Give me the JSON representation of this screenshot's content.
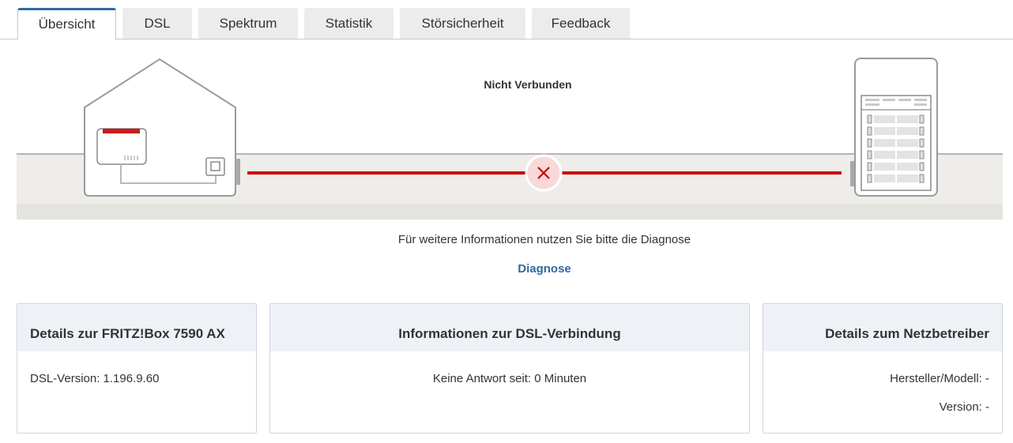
{
  "tabs": [
    {
      "label": "Übersicht",
      "active": true
    },
    {
      "label": "DSL"
    },
    {
      "label": "Spektrum"
    },
    {
      "label": "Statistik"
    },
    {
      "label": "Störsicherheit"
    },
    {
      "label": "Feedback"
    }
  ],
  "status": "Nicht Verbunden",
  "info_text": "Für weitere Informationen nutzen Sie bitte die Diagnose",
  "diagnose_link": "Diagnose",
  "colors": {
    "accent": "#2d6aa3",
    "error": "#cc0000",
    "card_head": "#eef2f7"
  },
  "cards": {
    "fritzbox": {
      "title": "Details zur FRITZ!Box 7590 AX",
      "dsl_version": "DSL-Version: 1.196.9.60"
    },
    "dsl": {
      "title": "Informationen zur DSL-Verbindung",
      "no_answer": "Keine Antwort seit: 0 Minuten"
    },
    "operator": {
      "title": "Details zum Netzbetreiber",
      "manufacturer": "Hersteller/Modell: -",
      "version": "Version: -"
    }
  }
}
